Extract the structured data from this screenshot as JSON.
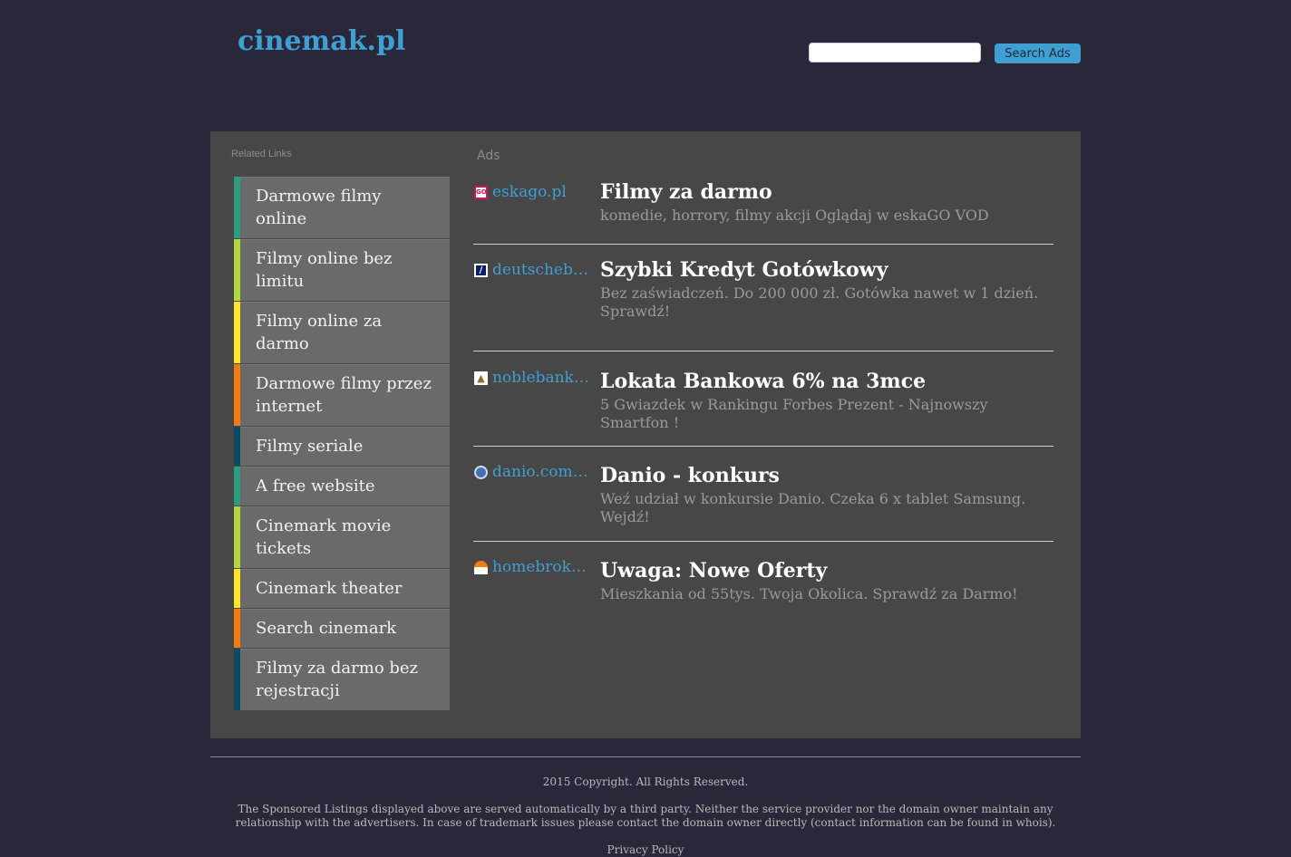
{
  "header": {
    "logo": "cinemak.pl",
    "search_placeholder": "",
    "search_button": "Search Ads"
  },
  "related": {
    "title": "Related Links",
    "items": [
      {
        "label": "Darmowe filmy online"
      },
      {
        "label": "Filmy online bez limitu"
      },
      {
        "label": "Filmy online za darmo"
      },
      {
        "label": "Darmowe filmy przez internet"
      },
      {
        "label": "Filmy seriale"
      },
      {
        "label": "A free website"
      },
      {
        "label": "Cinemark movie tickets"
      },
      {
        "label": "Cinemark theater"
      },
      {
        "label": "Search cinemark"
      },
      {
        "label": "Filmy za darmo bez rejestracji"
      }
    ]
  },
  "ads": {
    "title": "Ads",
    "items": [
      {
        "domain": "eskago.pl",
        "title": "Filmy za darmo",
        "desc": "komedie, horrory, filmy akcji Oglądaj w eskaGO VOD"
      },
      {
        "domain": "deutschebank.pl",
        "title": "Szybki Kredyt Gotówkowy",
        "desc": "Bez zaświadczeń. Do 200 000 zł. Gotówka nawet w 1 dzień. Sprawdź!"
      },
      {
        "domain": "noblebank.pl",
        "title": "Lokata Bankowa 6% na 3mce",
        "desc": "5 Gwiazdek w Rankingu Forbes Prezent - Najnowszy Smartfon !"
      },
      {
        "domain": "danio.com.pl",
        "title": "Danio - konkurs",
        "desc": "Weź udział w konkursie Danio. Czeka 6 x tablet Samsung. Wejdź!"
      },
      {
        "domain": "homebroker.pl",
        "title": "Uwaga: Nowe Oferty",
        "desc": "Mieszkania od 55tys. Twoja Okolica. Sprawdź za Darmo!"
      }
    ]
  },
  "footer": {
    "copyright": "2015 Copyright. All Rights Reserved.",
    "disclaimer": "The Sponsored Listings displayed above are served automatically by a third party. Neither the service provider nor the domain owner maintain any relationship with the advertisers. In case of trademark issues please contact the domain owner directly (contact information can be found in whois).",
    "privacy": "Privacy Policy"
  }
}
